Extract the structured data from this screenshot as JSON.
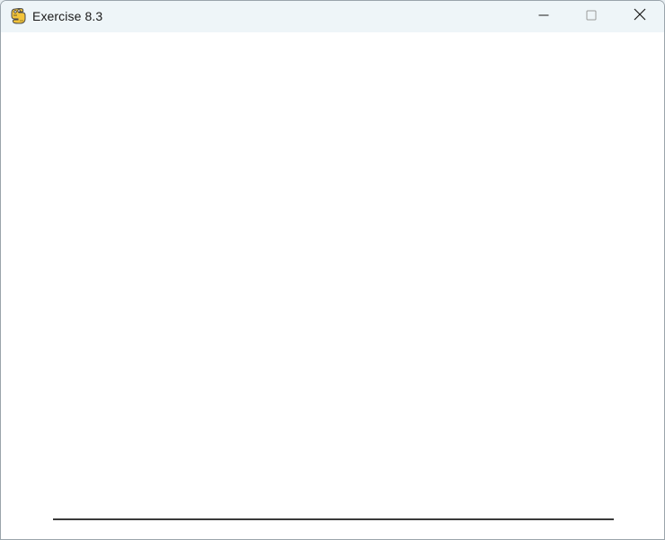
{
  "window": {
    "title": "Exercise 8.3",
    "app_icon": "pygame-snake-icon",
    "controls": {
      "minimize_icon": "minimize-icon",
      "maximize_icon": "maximize-icon",
      "close_icon": "close-icon"
    }
  },
  "canvas": {
    "background": "#ffffff",
    "line_color": "#3a3a3a"
  }
}
